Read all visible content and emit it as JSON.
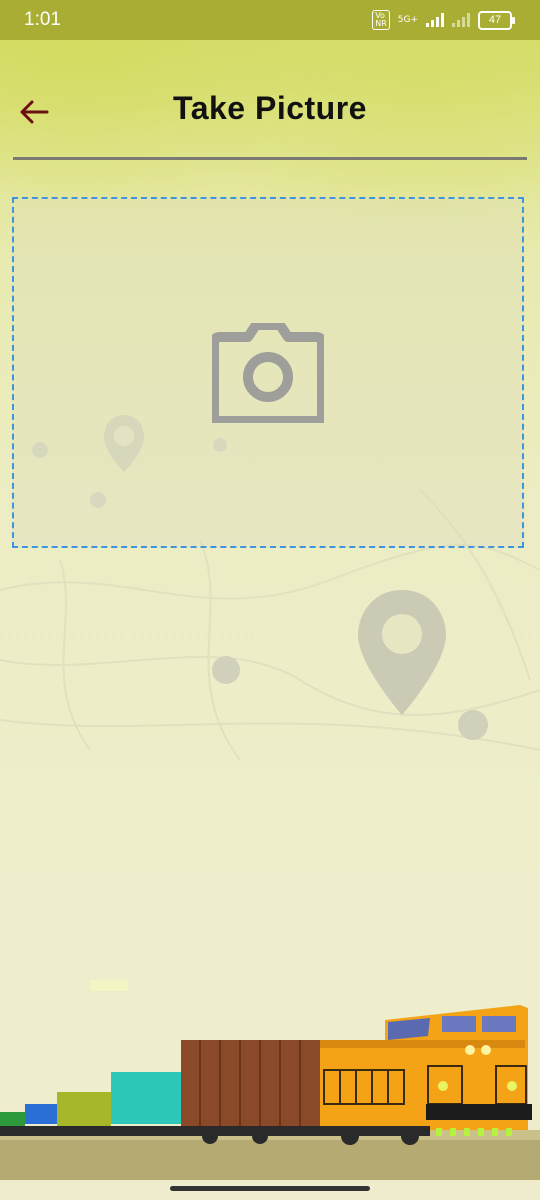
{
  "status_bar": {
    "time": "1:01",
    "volte_label": "Vo\nNR",
    "network_label": "5G+",
    "battery_level": "47"
  },
  "header": {
    "title": "Take Picture",
    "back_icon": "arrow-left-icon"
  },
  "upload": {
    "icon": "camera-icon"
  },
  "colors": {
    "status_bar": "#a9ad34",
    "title": "#111111",
    "back_arrow": "#6b1010",
    "dashed_border": "#3d95dc",
    "camera_icon": "#9e9e9a"
  }
}
